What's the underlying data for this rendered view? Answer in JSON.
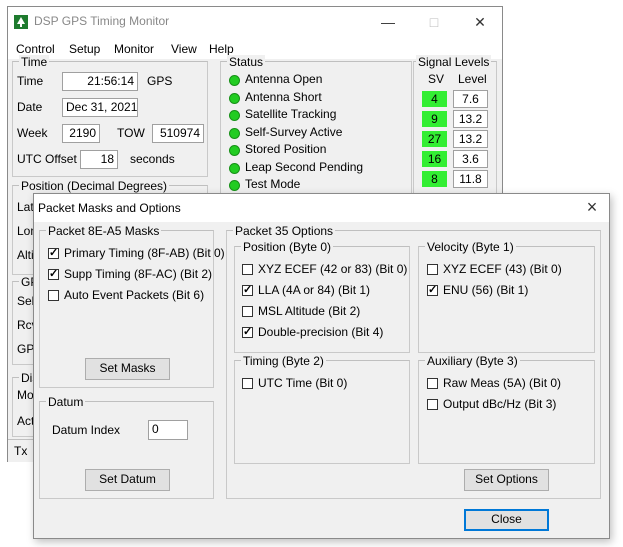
{
  "main": {
    "title": "DSP GPS Timing Monitor",
    "menu": [
      "Control",
      "Setup",
      "Monitor",
      "View",
      "Help"
    ],
    "time": {
      "legend": "Time",
      "time_label": "Time",
      "time_value": "21:56:14",
      "time_suffix": "GPS",
      "date_label": "Date",
      "date_value": "Dec 31, 2021",
      "week_label": "Week",
      "week_value": "2190",
      "tow_label": "TOW",
      "tow_value": "510974",
      "utc_label": "UTC Offset",
      "utc_value": "18",
      "utc_suffix": "seconds"
    },
    "status": {
      "legend": "Status",
      "items": [
        "Antenna Open",
        "Antenna Short",
        "Satellite Tracking",
        "Self-Survey Active",
        "Stored Position",
        "Leap Second Pending",
        "Test Mode"
      ],
      "led_color": "#22cc22"
    },
    "signal": {
      "legend": "Signal Levels",
      "sv_header": "SV",
      "level_header": "Level",
      "rows": [
        {
          "sv": "4",
          "level": "7.6"
        },
        {
          "sv": "9",
          "level": "13.2"
        },
        {
          "sv": "27",
          "level": "13.2"
        },
        {
          "sv": "16",
          "level": "3.6"
        },
        {
          "sv": "8",
          "level": "11.8"
        }
      ],
      "sv_color": "#33ee33"
    },
    "position": {
      "legend": "Position (Decimal Degrees)",
      "partial_labels": [
        "Lati",
        "Lon",
        "Alti"
      ]
    },
    "gps_group": {
      "legend": "GP",
      "partial_labels": [
        "Self",
        "Rcv",
        "GPS"
      ]
    },
    "dis_group": {
      "legend": "Dis",
      "partial_labels": [
        "Mo",
        "Acti"
      ]
    },
    "statusbar": "Tx"
  },
  "dialog": {
    "title": "Packet Masks and Options",
    "close_glyph": "×",
    "masks": {
      "legend": "Packet 8E-A5 Masks",
      "items": [
        {
          "label": "Primary Timing (8F-AB) (Bit 0)",
          "checked": true
        },
        {
          "label": "Supp Timing (8F-AC) (Bit 2)",
          "checked": true
        },
        {
          "label": "Auto Event Packets (Bit 6)",
          "checked": false
        }
      ],
      "button": "Set Masks"
    },
    "datum": {
      "legend": "Datum",
      "index_label": "Datum Index",
      "index_value": "0",
      "button": "Set Datum"
    },
    "p35": {
      "legend": "Packet 35 Options",
      "position": {
        "legend": "Position (Byte 0)",
        "items": [
          {
            "label": "XYZ ECEF (42 or 83) (Bit 0)",
            "checked": false
          },
          {
            "label": "LLA (4A or 84) (Bit 1)",
            "checked": true
          },
          {
            "label": "MSL Altitude (Bit 2)",
            "checked": false
          },
          {
            "label": "Double-precision (Bit 4)",
            "checked": true
          }
        ]
      },
      "velocity": {
        "legend": "Velocity (Byte 1)",
        "items": [
          {
            "label": "XYZ ECEF (43) (Bit 0)",
            "checked": false
          },
          {
            "label": "ENU (56) (Bit 1)",
            "checked": true
          }
        ]
      },
      "timing": {
        "legend": "Timing (Byte 2)",
        "items": [
          {
            "label": "UTC Time (Bit 0)",
            "checked": false
          }
        ]
      },
      "auxiliary": {
        "legend": "Auxiliary (Byte 3)",
        "items": [
          {
            "label": "Raw Meas (5A) (Bit 0)",
            "checked": false
          },
          {
            "label": "Output dBc/Hz (Bit 3)",
            "checked": false
          }
        ]
      },
      "button": "Set Options"
    },
    "close_button": "Close"
  }
}
